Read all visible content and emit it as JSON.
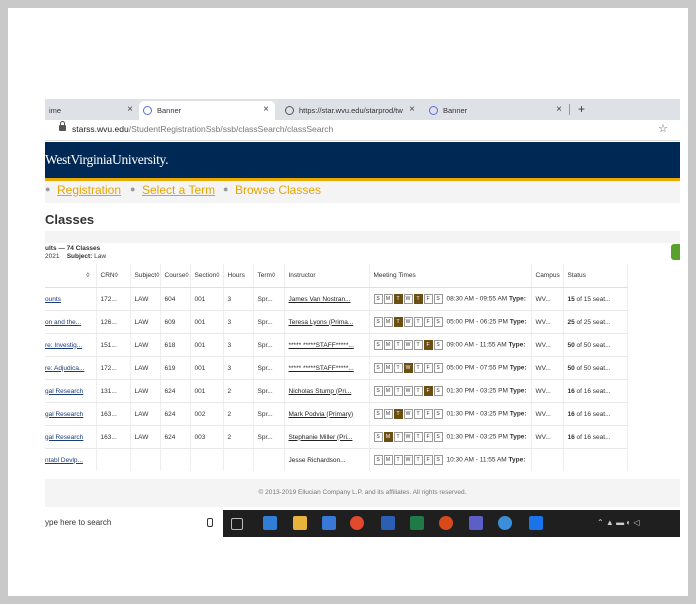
{
  "tabs": [
    {
      "label": "ime"
    },
    {
      "label": "Banner"
    },
    {
      "label": "https://star.wvu.edu/starprod/tw"
    },
    {
      "label": "Banner"
    }
  ],
  "address": {
    "host": "starss.wvu.edu",
    "path": "/StudentRegistrationSsb/ssb/classSearch/classSearch"
  },
  "header": {
    "brand": "WestVirginiaUniversity."
  },
  "breadcrumb": {
    "item1": "Registration",
    "item2": "Select a Term",
    "item3": "Browse Classes"
  },
  "page": {
    "title": "Classes"
  },
  "results": {
    "summary": "ults — 74 Classes",
    "term": "2021",
    "subject_label": "Subject:",
    "subject_value": "Law"
  },
  "columns": [
    "",
    "CRN",
    "Subject",
    "Course",
    "Section",
    "Hours",
    "Term",
    "Instructor",
    "Meeting Times",
    "Campus",
    "Status"
  ],
  "rows": [
    {
      "title": "ounts",
      "crn": "172...",
      "subject": "LAW",
      "course": "604",
      "section": "001",
      "hours": "3",
      "term": "Spr...",
      "instructor": "James Van Nostran...",
      "days_on": [
        false,
        false,
        true,
        false,
        true,
        false,
        false
      ],
      "time": "08:30 AM - 09:55 AM",
      "campus": "WV...",
      "seats": "15",
      "of": "of 15 seat..."
    },
    {
      "title": "on and the...",
      "crn": "126...",
      "subject": "LAW",
      "course": "609",
      "section": "001",
      "hours": "3",
      "term": "Spr...",
      "instructor": "Teresa Lyons (Prima...",
      "days_on": [
        false,
        false,
        true,
        false,
        false,
        false,
        false
      ],
      "time": "05:00 PM - 06:25 PM",
      "campus": "WV...",
      "seats": "25",
      "of": "of 25 seat..."
    },
    {
      "title": "re: Investig...",
      "crn": "151...",
      "subject": "LAW",
      "course": "618",
      "section": "001",
      "hours": "3",
      "term": "Spr...",
      "instructor": "***** *****STAFF*****...",
      "days_on": [
        false,
        false,
        false,
        false,
        false,
        true,
        false
      ],
      "time": "09:00 AM - 11:55 AM",
      "campus": "WV...",
      "seats": "50",
      "of": "of 50 seat..."
    },
    {
      "title": "re: Adjudica...",
      "crn": "172...",
      "subject": "LAW",
      "course": "619",
      "section": "001",
      "hours": "3",
      "term": "Spr...",
      "instructor": "***** *****STAFF*****...",
      "days_on": [
        false,
        false,
        false,
        true,
        false,
        false,
        false
      ],
      "time": "05:00 PM - 07:55 PM",
      "campus": "WV...",
      "seats": "50",
      "of": "of 50 seat..."
    },
    {
      "title": "gal Research",
      "crn": "131...",
      "subject": "LAW",
      "course": "624",
      "section": "001",
      "hours": "2",
      "term": "Spr...",
      "instructor": "Nicholas Stump (Pri...",
      "days_on": [
        false,
        false,
        false,
        false,
        false,
        true,
        false
      ],
      "time": "01:30 PM - 03:25 PM",
      "campus": "WV...",
      "seats": "16",
      "of": "of 16 seat..."
    },
    {
      "title": "gal Research",
      "crn": "163...",
      "subject": "LAW",
      "course": "624",
      "section": "002",
      "hours": "2",
      "term": "Spr...",
      "instructor": "Mark Podvia (Primary)",
      "days_on": [
        false,
        false,
        true,
        false,
        false,
        false,
        false
      ],
      "time": "01:30 PM - 03:25 PM",
      "campus": "WV...",
      "seats": "16",
      "of": "of 16 seat..."
    },
    {
      "title": "gal Research",
      "crn": "163...",
      "subject": "LAW",
      "course": "624",
      "section": "003",
      "hours": "2",
      "term": "Spr...",
      "instructor": "Stephanie Miller (Pri...",
      "days_on": [
        false,
        true,
        false,
        false,
        false,
        false,
        false
      ],
      "time": "01:30 PM - 03:25 PM",
      "campus": "WV...",
      "seats": "16",
      "of": "of 16 seat..."
    },
    {
      "title": "ntabl Devlp...",
      "crn": "",
      "subject": "",
      "course": "",
      "section": "",
      "hours": "",
      "term": "",
      "instructor": "Jesse Richardson...",
      "days_on": [
        false,
        false,
        false,
        false,
        false,
        false,
        false
      ],
      "time": "10:30 AM - 11:55 AM",
      "campus": "",
      "seats": "",
      "of": ""
    }
  ],
  "type_label": "Type:",
  "day_letters": [
    "S",
    "M",
    "T",
    "W",
    "T",
    "F",
    "S"
  ],
  "footer": {
    "text": "© 2013-2019 Ellucian Company L.P. and its affiliates. All rights reserved."
  },
  "taskbar": {
    "search_placeholder": "ype here to search"
  },
  "colors": {
    "navy": "#002855",
    "gold": "#eaaa00",
    "day_on": "#6b4f12",
    "link": "#e8a400"
  }
}
